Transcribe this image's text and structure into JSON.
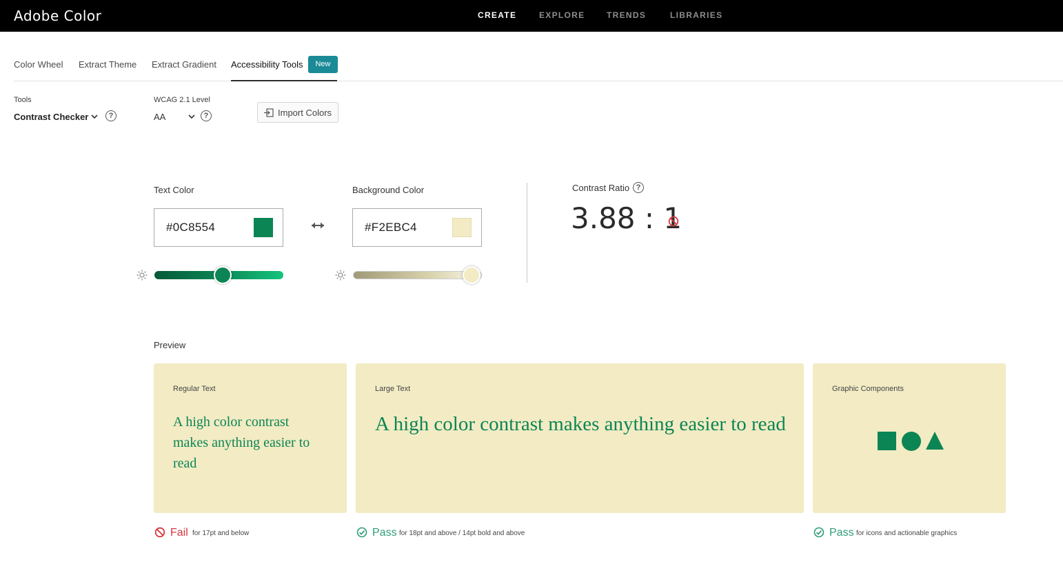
{
  "app": {
    "title": "Adobe Color"
  },
  "topnav": [
    {
      "label": "CREATE",
      "active": true
    },
    {
      "label": "EXPLORE",
      "active": false
    },
    {
      "label": "TRENDS",
      "active": false
    },
    {
      "label": "LIBRARIES",
      "active": false
    }
  ],
  "subnav": [
    {
      "label": "Color Wheel"
    },
    {
      "label": "Extract Theme"
    },
    {
      "label": "Extract Gradient"
    },
    {
      "label": "Accessibility Tools",
      "active": true,
      "badge": "New"
    }
  ],
  "toolbar": {
    "tools_label": "Tools",
    "tools_value": "Contrast Checker",
    "wcag_label": "WCAG 2.1 Level",
    "wcag_value": "AA",
    "import_label": "Import Colors"
  },
  "text_color": {
    "label": "Text Color",
    "hex": "#0C8554",
    "brightness_fraction": 0.53
  },
  "background_color": {
    "label": "Background Color",
    "hex": "#F2EBC4",
    "brightness_fraction": 0.92
  },
  "contrast": {
    "label": "Contrast Ratio",
    "value": "3.88 : 1",
    "status": "fail"
  },
  "preview": {
    "label": "Preview",
    "cards": [
      {
        "title": "Regular Text",
        "sample": "A high color contrast makes anything easier to read",
        "result": "Fail",
        "note": "for 17pt and below"
      },
      {
        "title": "Large Text",
        "sample": "A high color contrast makes anything easier to read",
        "result": "Pass",
        "note": "for 18pt and above / 14pt bold and above"
      },
      {
        "title": "Graphic Components",
        "result": "Pass",
        "note": "for icons and actionable graphics"
      }
    ]
  },
  "colors": {
    "fail": "#d7373f",
    "pass": "#2d9d78",
    "badge": "#1a8a96"
  }
}
